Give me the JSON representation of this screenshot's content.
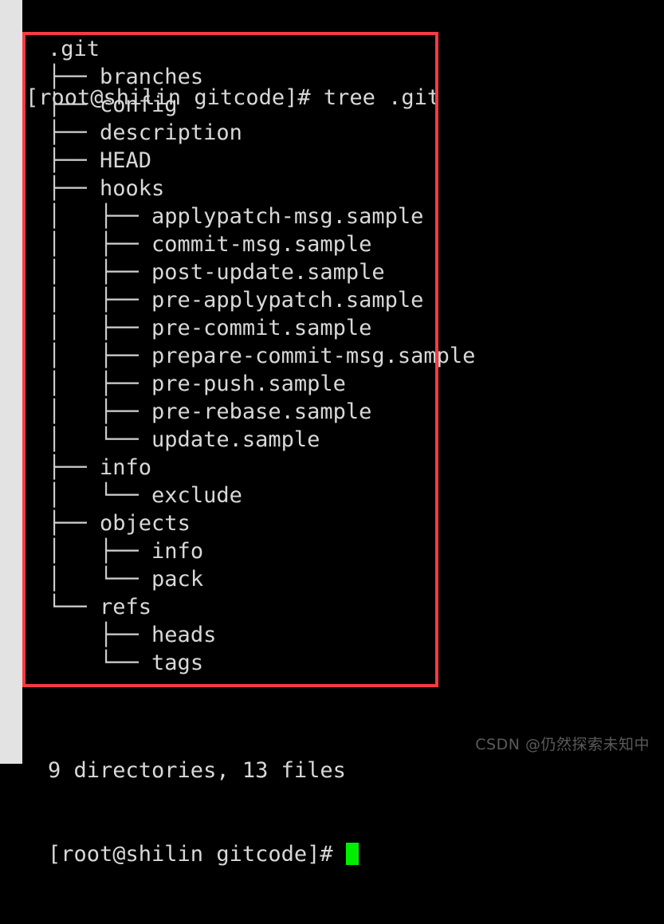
{
  "terminal": {
    "background_color": "#000000",
    "text_color": "#d8d8d8",
    "cursor_color": "#00ee00",
    "prompt": "[root@shilin gitcode]# ",
    "command_line": "[root@shilin gitcode]# tree .git",
    "summary": "9 directories, 13 files",
    "final_prompt": "[root@shilin gitcode]# "
  },
  "annotation": {
    "box_color": "#f73b42"
  },
  "watermark": {
    "text": "CSDN @仍然探索未知中"
  },
  "tree": {
    "root": ".git",
    "rows": [
      {
        "prefix": "",
        "name": ".git"
      },
      {
        "prefix": "├── ",
        "name": "branches"
      },
      {
        "prefix": "├── ",
        "name": "config"
      },
      {
        "prefix": "├── ",
        "name": "description"
      },
      {
        "prefix": "├── ",
        "name": "HEAD"
      },
      {
        "prefix": "├── ",
        "name": "hooks"
      },
      {
        "prefix": "│   ├── ",
        "name": "applypatch-msg.sample"
      },
      {
        "prefix": "│   ├── ",
        "name": "commit-msg.sample"
      },
      {
        "prefix": "│   ├── ",
        "name": "post-update.sample"
      },
      {
        "prefix": "│   ├── ",
        "name": "pre-applypatch.sample"
      },
      {
        "prefix": "│   ├── ",
        "name": "pre-commit.sample"
      },
      {
        "prefix": "│   ├── ",
        "name": "prepare-commit-msg.sample"
      },
      {
        "prefix": "│   ├── ",
        "name": "pre-push.sample"
      },
      {
        "prefix": "│   ├── ",
        "name": "pre-rebase.sample"
      },
      {
        "prefix": "│   └── ",
        "name": "update.sample"
      },
      {
        "prefix": "├── ",
        "name": "info"
      },
      {
        "prefix": "│   └── ",
        "name": "exclude"
      },
      {
        "prefix": "├── ",
        "name": "objects"
      },
      {
        "prefix": "│   ├── ",
        "name": "info"
      },
      {
        "prefix": "│   └── ",
        "name": "pack"
      },
      {
        "prefix": "└── ",
        "name": "refs"
      },
      {
        "prefix": "    ├── ",
        "name": "heads"
      },
      {
        "prefix": "    └── ",
        "name": "tags"
      }
    ]
  }
}
